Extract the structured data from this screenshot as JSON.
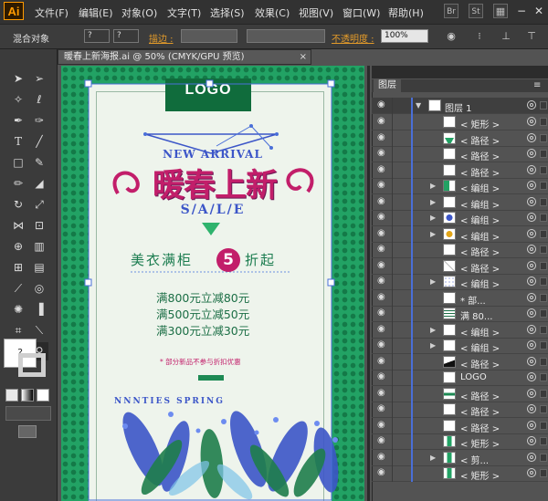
{
  "app": {
    "logo": "Ai"
  },
  "menu": [
    "文件(F)",
    "编辑(E)",
    "对象(O)",
    "文字(T)",
    "选择(S)",
    "效果(C)",
    "视图(V)",
    "窗口(W)",
    "帮助(H)"
  ],
  "menubar_icons": {
    "bridge": "Br",
    "stock": "St"
  },
  "control_bar": {
    "object_type": "混合对象",
    "stroke_label": "描边 :",
    "opacity_label": "不透明度 :",
    "opacity_value": "100%",
    "question": "?"
  },
  "document": {
    "tab_title": "暖春上新海报.ai @ 50% (CMYK/GPU 预览)",
    "close": "×"
  },
  "poster": {
    "logo": "LOGO",
    "new_arrival": "NEW ARRIVAL",
    "title": "暖春上新",
    "sale": "S/A/L/E",
    "promo_left": "美衣满柜",
    "promo_number": "5",
    "promo_right": "折起",
    "deals": [
      "满800元立减80元",
      "满500元立减50元",
      "满300元立减30元"
    ],
    "note": "* 部分新品不参与折扣优惠",
    "spring": "NNNTIES  SPRING"
  },
  "colors": {
    "accent_green": "#22a264",
    "title_magenta": "#c21e6a",
    "blue": "#3c56c8",
    "selection_blue": "#4a6fd8"
  },
  "layers_panel": {
    "tab": "图层",
    "top_layer": "图层 1",
    "rows": [
      {
        "name": "< 矩形 >",
        "expand": false,
        "thumb": "white"
      },
      {
        "name": "< 路径 >",
        "expand": false,
        "thumb": "green-triangle"
      },
      {
        "name": "< 路径 >",
        "expand": false,
        "thumb": "white"
      },
      {
        "name": "< 路径 >",
        "expand": false,
        "thumb": "white"
      },
      {
        "name": "< 编组 >",
        "expand": true,
        "thumb": "pattern-green"
      },
      {
        "name": "< 编组 >",
        "expand": true,
        "thumb": "white"
      },
      {
        "name": "< 编组 >",
        "expand": true,
        "thumb": "leaf-blue"
      },
      {
        "name": "< 编组 >",
        "expand": true,
        "thumb": "leaf-yellow"
      },
      {
        "name": "< 路径 >",
        "expand": false,
        "thumb": "white"
      },
      {
        "name": "< 路径 >",
        "expand": false,
        "thumb": "line"
      },
      {
        "name": "< 编组 >",
        "expand": true,
        "thumb": "dots"
      },
      {
        "name": "* 部...",
        "expand": false,
        "thumb": "white"
      },
      {
        "name": "满 80...",
        "expand": false,
        "thumb": "bars"
      },
      {
        "name": "< 编组 >",
        "expand": true,
        "thumb": "white"
      },
      {
        "name": "< 编组 >",
        "expand": true,
        "thumb": "white"
      },
      {
        "name": "< 路径 >",
        "expand": false,
        "thumb": "wedge"
      },
      {
        "name": "LOGO",
        "expand": false,
        "thumb": "white"
      },
      {
        "name": "< 路径 >",
        "expand": false,
        "thumb": "green-bar"
      },
      {
        "name": "< 路径 >",
        "expand": false,
        "thumb": "white"
      },
      {
        "name": "< 路径 >",
        "expand": false,
        "thumb": "white"
      },
      {
        "name": "< 矩形 >",
        "expand": false,
        "thumb": "green-bar-v"
      },
      {
        "name": "< 剪...",
        "expand": true,
        "thumb": "green-bar-v"
      },
      {
        "name": "< 矩形 >",
        "expand": false,
        "thumb": "green-bar-v"
      }
    ]
  }
}
